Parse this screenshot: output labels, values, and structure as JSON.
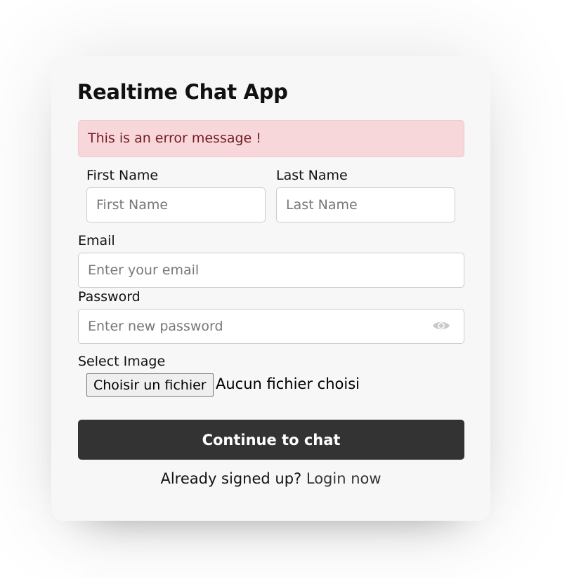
{
  "app": {
    "title": "Realtime Chat App"
  },
  "error": {
    "message": "This is an error message !",
    "bg_color": "#f8d7da",
    "text_color": "#721c24"
  },
  "form": {
    "first_name": {
      "label": "First Name",
      "placeholder": "First Name",
      "value": ""
    },
    "last_name": {
      "label": "Last Name",
      "placeholder": "Last Name",
      "value": ""
    },
    "email": {
      "label": "Email",
      "placeholder": "Enter your email",
      "value": ""
    },
    "password": {
      "label": "Password",
      "placeholder": "Enter new password",
      "value": "",
      "toggle_icon": "eye-icon"
    },
    "image": {
      "label": "Select Image",
      "button_label": "Choisir un fichier",
      "status": "Aucun fichier choisi"
    }
  },
  "submit": {
    "label": "Continue to chat",
    "color": "#333333"
  },
  "footer": {
    "prompt": "Already signed up?",
    "link_label": "Login now"
  }
}
